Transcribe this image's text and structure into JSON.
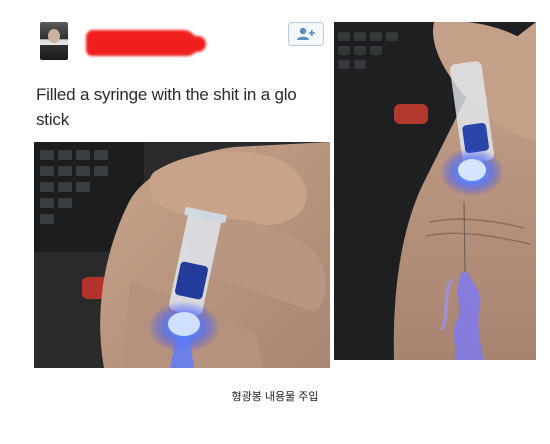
{
  "post": {
    "author_avatar": "avatar",
    "author_name_redacted": true,
    "follow_icon": "add-user-icon",
    "text": "Filled a syringe with the shit in a glo stick"
  },
  "photos": {
    "left": "hand-holding-glowing-syringe",
    "right": "wrist-with-glowing-fluid"
  },
  "colors": {
    "glow": "#3b6cff",
    "redaction": "#ef1f1f",
    "follow_border": "#b5cbe0",
    "follow_icon": "#5d8fc4"
  },
  "caption": "형광봉 내용물 주입"
}
